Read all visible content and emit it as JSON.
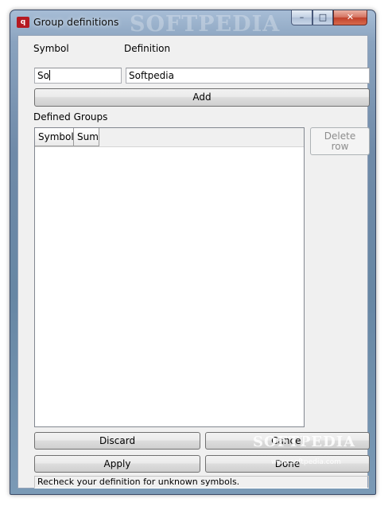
{
  "window": {
    "title": "Group definitions",
    "icon_text": "q",
    "controls": {
      "minimize": "–",
      "maximize": "□",
      "close": "✕"
    }
  },
  "form": {
    "symbol_label": "Symbol",
    "symbol_value": "So",
    "definition_label": "Definition",
    "definition_value": "Softpedia",
    "add_label": "Add"
  },
  "groups": {
    "label": "Defined Groups",
    "columns": [
      "Symbol",
      "Sum"
    ],
    "rows": [],
    "delete_label_line1": "Delete",
    "delete_label_line2": "row"
  },
  "actions": {
    "discard": "Discard",
    "cancel": "Cancel",
    "apply": "Apply",
    "done": "Done"
  },
  "status": {
    "text": "Recheck your definition for unknown symbols."
  },
  "watermark": {
    "brand": "SOFTPEDIA",
    "url": "www.softpedia.com"
  }
}
